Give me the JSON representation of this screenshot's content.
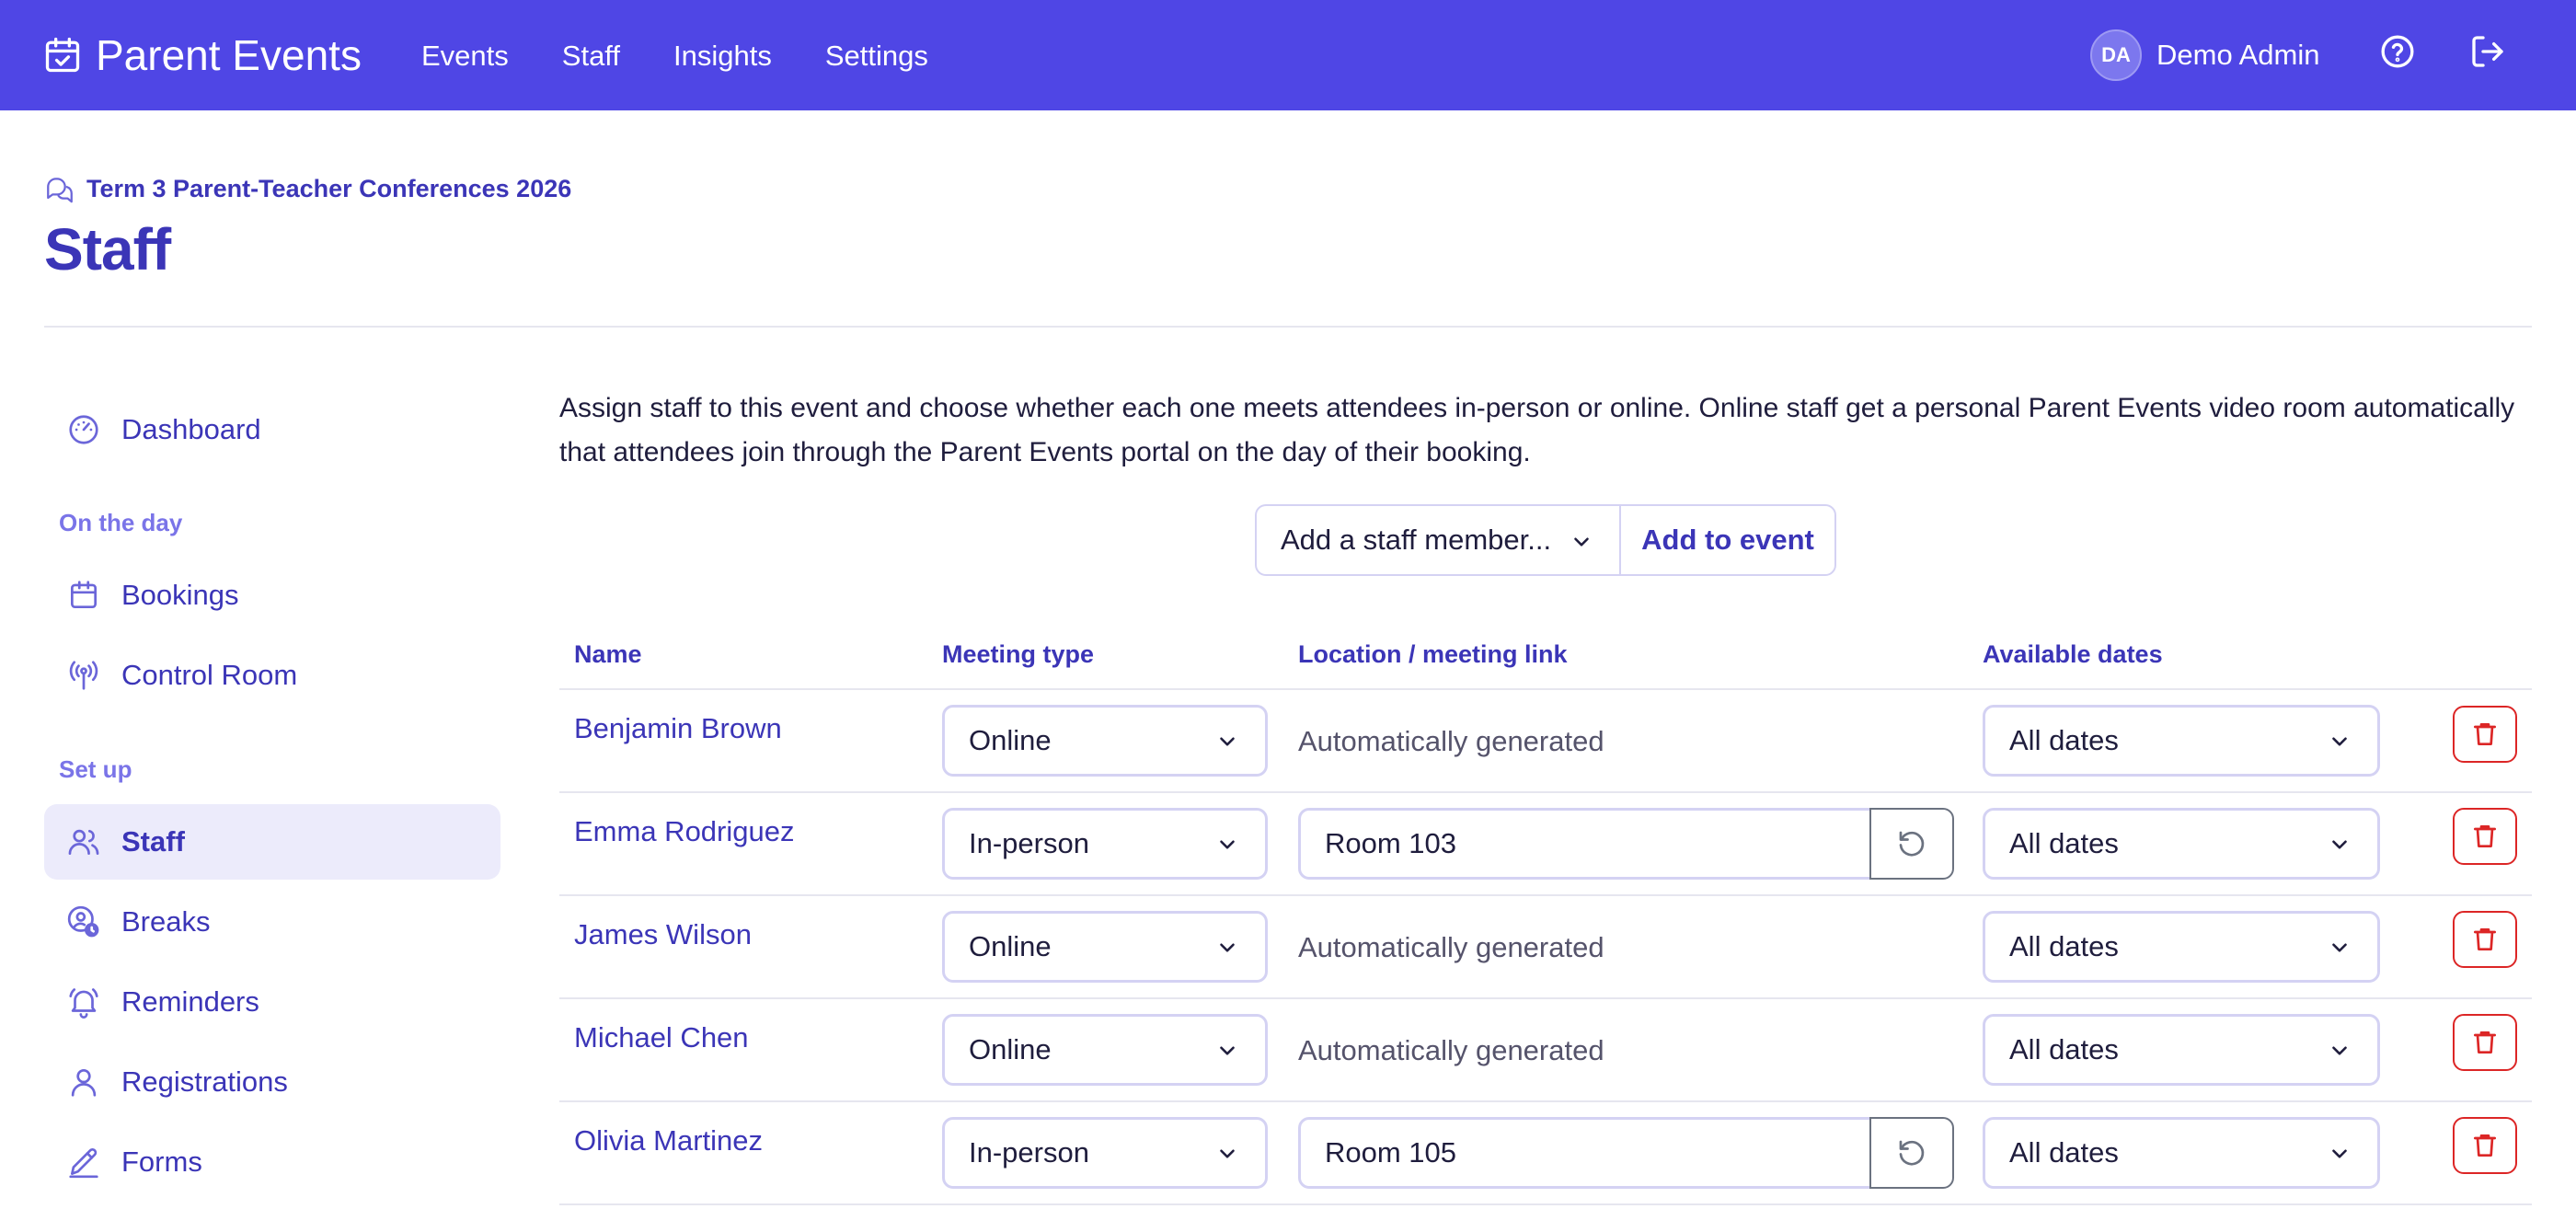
{
  "app": {
    "brand": "Parent Events"
  },
  "nav": {
    "links": [
      "Events",
      "Staff",
      "Insights",
      "Settings"
    ]
  },
  "user": {
    "initials": "DA",
    "name": "Demo Admin"
  },
  "breadcrumb": "Term 3 Parent-Teacher Conferences 2026",
  "page_title": "Staff",
  "sidebar": {
    "dashboard": "Dashboard",
    "section_on_the_day": "On the day",
    "bookings": "Bookings",
    "control_room": "Control Room",
    "section_set_up": "Set up",
    "staff": "Staff",
    "breaks": "Breaks",
    "reminders": "Reminders",
    "registrations": "Registrations",
    "forms": "Forms"
  },
  "intro": "Assign staff to this event and choose whether each one meets attendees in-person or online. Online staff get a personal Parent Events video room automatically that attendees join through the Parent Events portal on the day of their booking.",
  "add_staff": {
    "placeholder": "Add a staff member...",
    "button": "Add to event"
  },
  "table": {
    "headers": {
      "name": "Name",
      "meeting_type": "Meeting type",
      "location": "Location / meeting link",
      "dates": "Available dates"
    },
    "rows": [
      {
        "name": "Benjamin Brown",
        "meeting_type": "Online",
        "location": "Automatically generated",
        "dates": "All dates"
      },
      {
        "name": "Emma Rodriguez",
        "meeting_type": "In-person",
        "location": "Room 103",
        "dates": "All dates"
      },
      {
        "name": "James Wilson",
        "meeting_type": "Online",
        "location": "Automatically generated",
        "dates": "All dates"
      },
      {
        "name": "Michael Chen",
        "meeting_type": "Online",
        "location": "Automatically generated",
        "dates": "All dates"
      },
      {
        "name": "Olivia Martinez",
        "meeting_type": "In-person",
        "location": "Room 105",
        "dates": "All dates"
      }
    ]
  },
  "colors": {
    "topbar": "#4f46e5",
    "accent": "#3b35b7",
    "danger": "#dc2626",
    "active_bg": "#ecebfb"
  }
}
